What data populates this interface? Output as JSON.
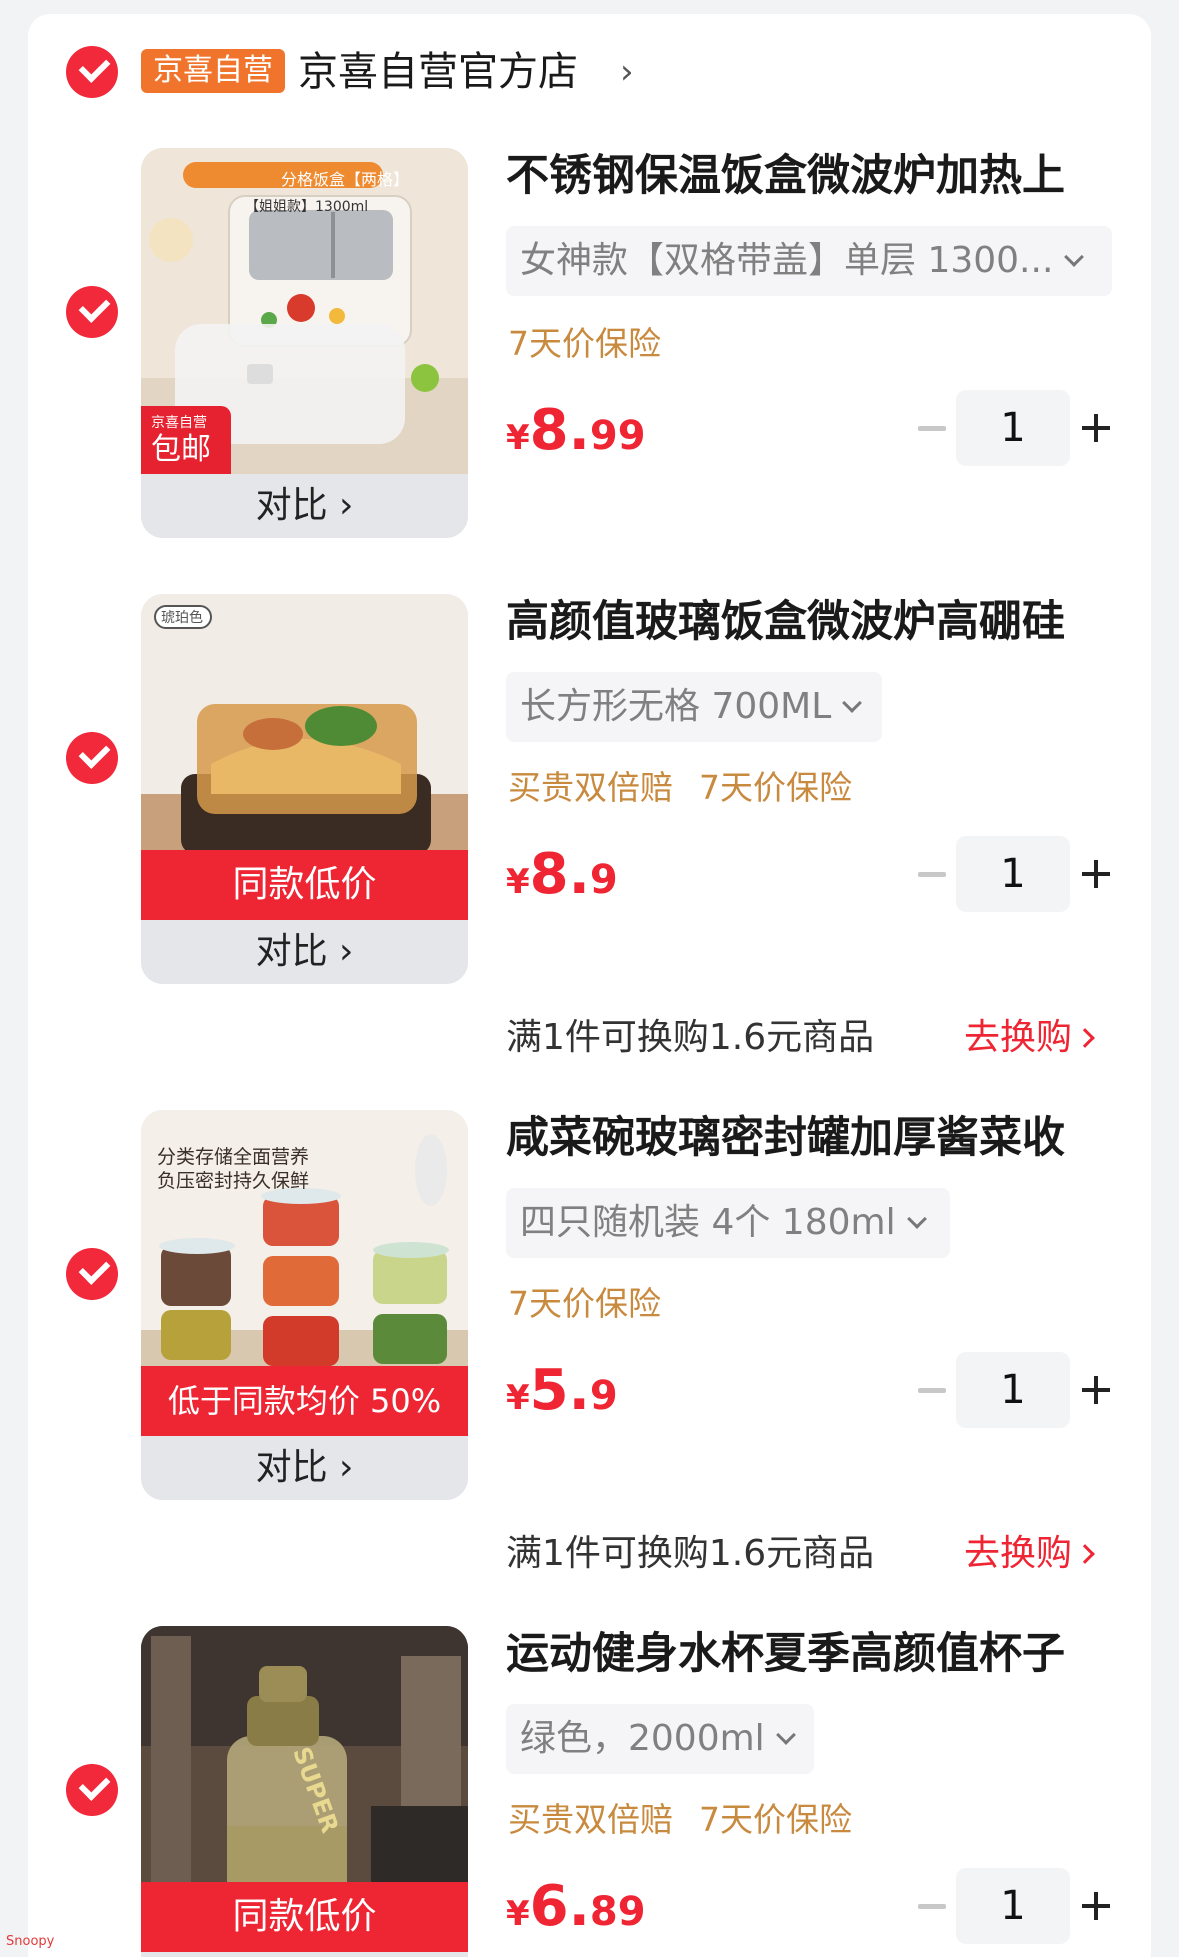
{
  "shop": {
    "badge": "京喜自营",
    "name": "京喜自营官方店",
    "chevron": "›"
  },
  "compare_label": "对比",
  "products": [
    {
      "title": "不锈钢保温饭盒微波炉加热上",
      "spec": "女神款【双格带盖】单层 1300...",
      "tags": [
        "7天价保险"
      ],
      "price": {
        "currency": "¥",
        "int": "8.",
        "dec": "99"
      },
      "qty": "1",
      "image": {
        "label_top": "分格饭盒【两格】",
        "label_sub": "【姐姐款】1300ml",
        "badge_small": "京喜自营",
        "badge_big": "包邮"
      }
    },
    {
      "title": "高颜值玻璃饭盒微波炉高硼硅",
      "spec": "长方形无格 700ML",
      "tags": [
        "买贵双倍赔",
        "7天价保险"
      ],
      "price": {
        "currency": "¥",
        "int": "8.",
        "dec": "9"
      },
      "qty": "1",
      "image": {
        "corner": "琥珀色",
        "banner": "同款低价"
      }
    },
    {
      "title": "咸菜碗玻璃密封罐加厚酱菜收",
      "spec": "四只随机装 4个 180ml",
      "tags": [
        "7天价保险"
      ],
      "price": {
        "currency": "¥",
        "int": "5.",
        "dec": "9"
      },
      "qty": "1",
      "image": {
        "line1": "分类存储全面营养",
        "line2": "负压密封持久保鲜",
        "banner": "低于同款均价 50%"
      }
    },
    {
      "title": "运动健身水杯夏季高颜值杯子",
      "spec": "绿色，2000ml",
      "tags": [
        "买贵双倍赔",
        "7天价保险"
      ],
      "price": {
        "currency": "¥",
        "int": "6.",
        "dec": "89"
      },
      "qty": "1",
      "image": {
        "banner": "同款低价",
        "bottle_text": "SUPER"
      }
    }
  ],
  "promo": {
    "text": "满1件可换购1.6元商品",
    "link": "去换购"
  },
  "watermark": "Snoopy",
  "colors": {
    "accent_red": "#ef2533",
    "badge_orange": "#f0742b",
    "tag_gold": "#c88a3e"
  }
}
